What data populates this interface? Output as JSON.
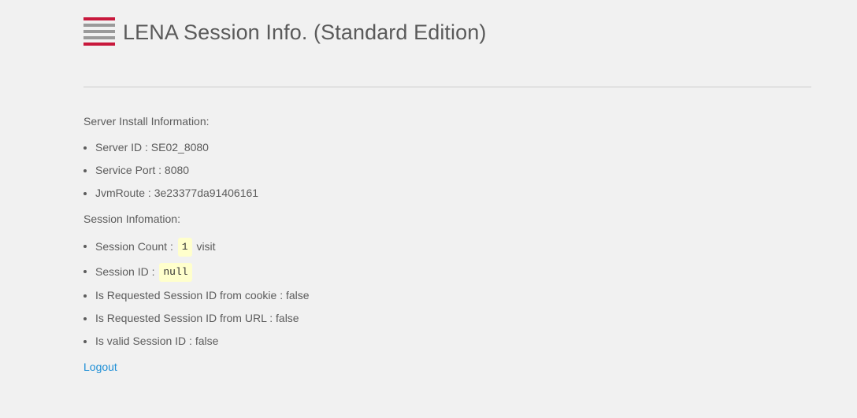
{
  "header": {
    "title": "LENA Session Info. (Standard Edition)",
    "logo_icon": "lena-logo-icon",
    "logo_colors": {
      "red": "#c8183c",
      "gray": "#9a9a9a"
    }
  },
  "server_section": {
    "title": "Server Install Information:",
    "items": [
      "Server ID : SE02_8080",
      "Service Port : 8080",
      "JvmRoute : 3e23377da91406161"
    ]
  },
  "session_section": {
    "title": "Session Infomation:",
    "count_label": "Session Count :",
    "count_value": "1",
    "count_suffix": "visit",
    "id_label": "Session ID :",
    "id_value": "null",
    "items": [
      "Is Requested Session ID from cookie : false",
      "Is Requested Session ID from URL : false",
      "Is valid Session ID : false"
    ]
  },
  "logout_label": "Logout",
  "colors": {
    "background": "#f1f1f1",
    "text": "#5c5c5c",
    "link": "#1f8fd6",
    "code_background": "#ffffcc"
  }
}
